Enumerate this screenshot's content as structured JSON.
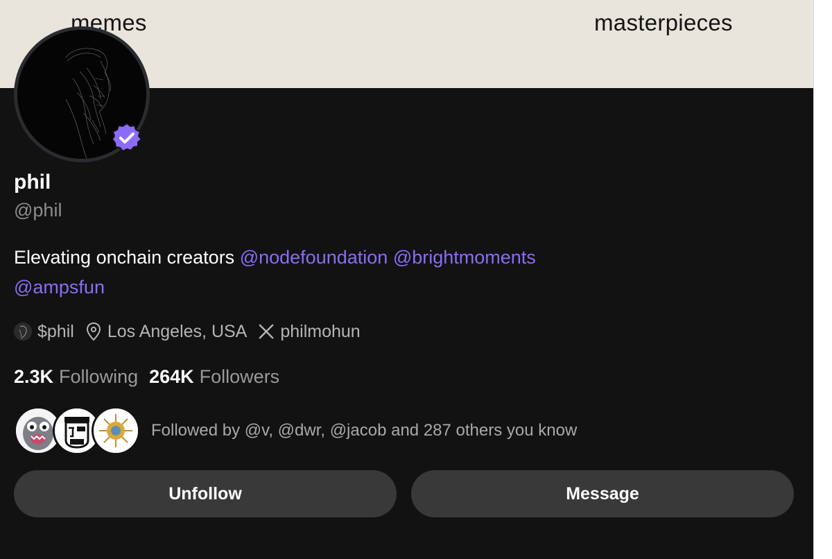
{
  "banner": {
    "left_label": "memes",
    "right_label": "masterpieces"
  },
  "profile": {
    "avatar_icon": "profile-portrait",
    "verified_icon": "verified-badge-icon",
    "verified_color": "#8b6cf6",
    "name": "phil",
    "handle": "@phil",
    "bio": {
      "text": "Elevating onchain creators",
      "mentions": [
        "@nodefoundation",
        "@brightmoments",
        "@ampsfun"
      ]
    },
    "meta": {
      "token": "$phil",
      "location": "Los Angeles, USA",
      "x_handle": "philmohun"
    },
    "stats": {
      "following_count": "2.3K",
      "following_label": "Following",
      "followers_count": "264K",
      "followers_label": "Followers"
    },
    "followed_by": "Followed by @v, @dwr, @jacob and 287 others you know"
  },
  "actions": {
    "unfollow_label": "Unfollow",
    "message_label": "Message"
  },
  "colors": {
    "background": "#121212",
    "banner": "#e9e5dc",
    "accent": "#8b6cf6",
    "button": "#393939"
  }
}
